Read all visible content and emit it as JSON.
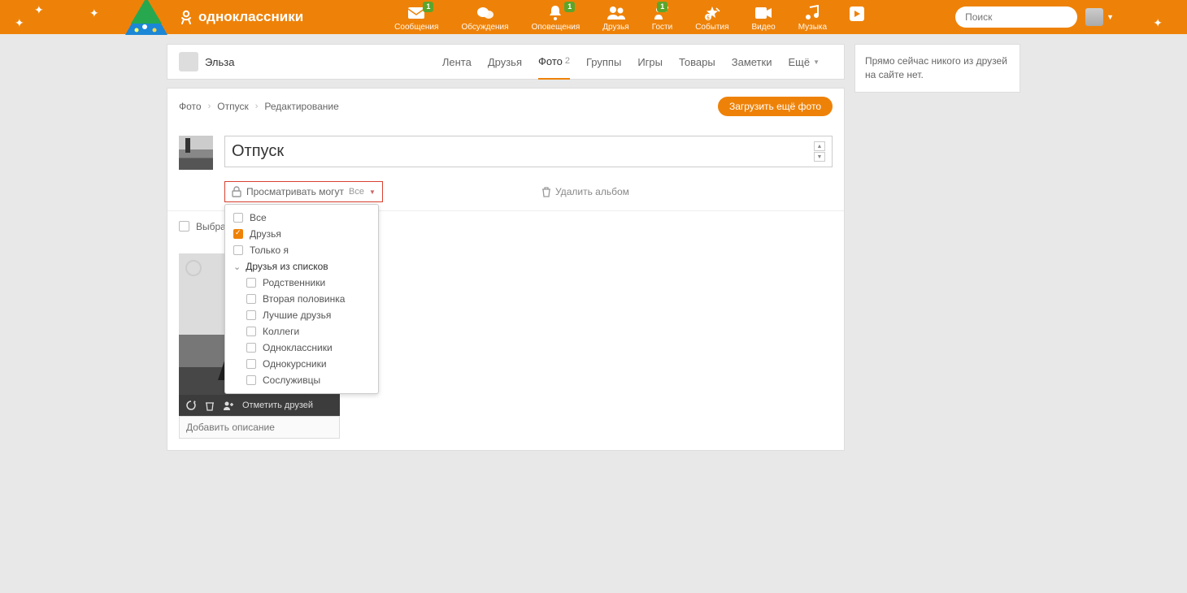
{
  "brand_text": "одноклассники",
  "search_placeholder": "Поиск",
  "nav": [
    {
      "label": "Сообщения",
      "badge": "1"
    },
    {
      "label": "Обсуждения",
      "badge": null
    },
    {
      "label": "Оповещения",
      "badge": "1"
    },
    {
      "label": "Друзья",
      "badge": null
    },
    {
      "label": "Гости",
      "badge": "1"
    },
    {
      "label": "События",
      "badge": null
    },
    {
      "label": "Видео",
      "badge": null
    },
    {
      "label": "Музыка",
      "badge": null
    }
  ],
  "profile_name": "Эльза",
  "tabs": [
    {
      "label": "Лента",
      "active": false,
      "count": null
    },
    {
      "label": "Друзья",
      "active": false,
      "count": null
    },
    {
      "label": "Фото",
      "active": true,
      "count": "2"
    },
    {
      "label": "Группы",
      "active": false,
      "count": null
    },
    {
      "label": "Игры",
      "active": false,
      "count": null
    },
    {
      "label": "Товары",
      "active": false,
      "count": null
    },
    {
      "label": "Заметки",
      "active": false,
      "count": null
    }
  ],
  "tab_more": "Ещё",
  "breadcrumb": [
    "Фото",
    "Отпуск",
    "Редактирование"
  ],
  "upload_more": "Загрузить ещё фото",
  "album_title": "Отпуск",
  "privacy_label": "Просматривать могут",
  "privacy_value": "Все",
  "delete_album": "Удалить альбом",
  "privacy_options": {
    "top": [
      {
        "label": "Все",
        "checked": false
      },
      {
        "label": "Друзья",
        "checked": true
      },
      {
        "label": "Только я",
        "checked": false
      }
    ],
    "group_label": "Друзья из списков",
    "sub": [
      {
        "label": "Родственники",
        "checked": false
      },
      {
        "label": "Вторая половинка",
        "checked": false
      },
      {
        "label": "Лучшие друзья",
        "checked": false
      },
      {
        "label": "Коллеги",
        "checked": false
      },
      {
        "label": "Одноклассники",
        "checked": false
      },
      {
        "label": "Однокурсники",
        "checked": false
      },
      {
        "label": "Сослуживцы",
        "checked": false
      }
    ]
  },
  "select_all": "Выбрать все фотографии",
  "tag_friends": "Отметить друзей",
  "desc_placeholder": "Добавить описание",
  "aside_empty": "Прямо сейчас никого из друзей на сайте нет."
}
